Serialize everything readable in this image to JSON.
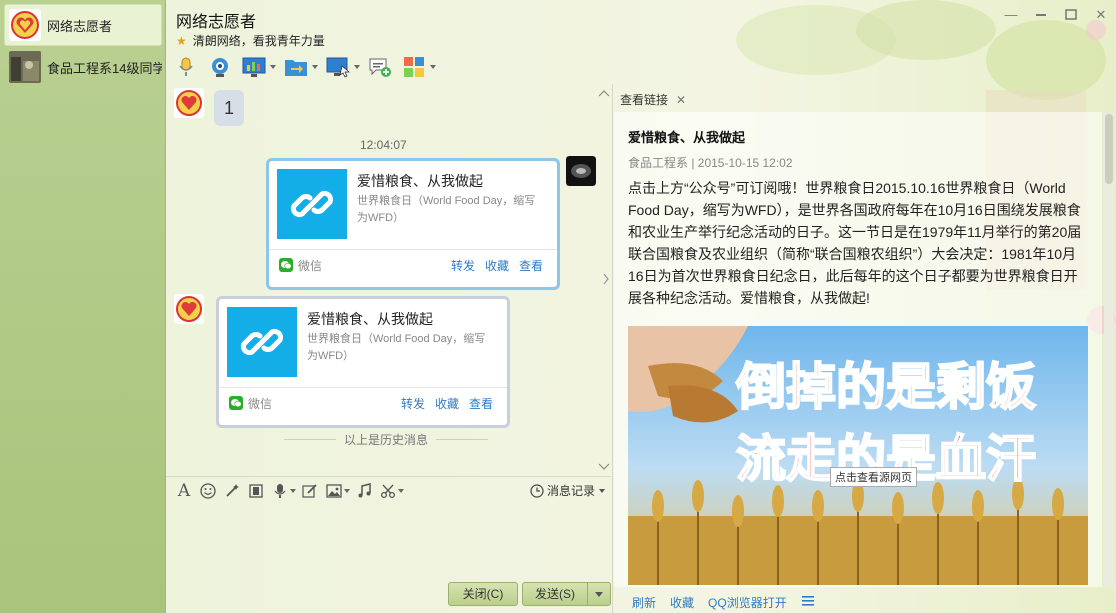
{
  "sidebar": {
    "contacts": [
      {
        "name": "网络志愿者",
        "active": true
      },
      {
        "name": "食品工程系14级同学",
        "active": false
      }
    ]
  },
  "header": {
    "title": "网络志愿者",
    "subtitle": "清朗网络，看我青年力量"
  },
  "toolbar_icons": [
    "microphone-icon",
    "webcam-icon",
    "screen-share-icon",
    "file-transfer-icon",
    "remote-desktop-icon",
    "add-app-icon",
    "apps-grid-icon"
  ],
  "chat": {
    "first_message": "1",
    "timestamp": "12:04:07",
    "card": {
      "title": "爱惜粮食、从我做起",
      "desc": "世界粮食日（World Food Day，缩写为WFD）",
      "source": "微信",
      "actions": [
        "转发",
        "收藏",
        "查看"
      ]
    },
    "history_separator": "以上是历史消息"
  },
  "input": {
    "history_label": "消息记录",
    "close_label": "关闭(C)",
    "send_label": "发送(S)"
  },
  "panel": {
    "tab_label": "查看链接",
    "article_title": "爱惜粮食、从我做起",
    "meta": "食品工程系 | 2015-10-15 12:02",
    "body": "点击上方“公众号”可订阅哦！世界粮食日2015.10.16世界粮食日（World Food Day，缩写为WFD），是世界各国政府每年在10月16日围绕发展粮食和农业生产举行纪念活动的日子。这一节日是在1979年11月举行的第20届联合国粮食及农业组织（简称“联合国粮农组织”）大会决定：1981年10月16日为首次世界粮食日纪念日，此后每年的这个日子都要为世界粮食日开展各种纪念活动。爱惜粮食，从我做起!",
    "image_text_line1": "倒掉的是剩饭",
    "image_text_line2": "流走的是血汗",
    "tooltip": "点击查看源网页",
    "footer": [
      "刷新",
      "收藏",
      "QQ浏览器打开"
    ]
  },
  "colors": {
    "accent_blue": "#13aee8",
    "link_blue": "#2e7bc6",
    "sidebar_green": "#b9d091",
    "wechat_green": "#2aae2a",
    "poster_red": "#e8321e"
  }
}
